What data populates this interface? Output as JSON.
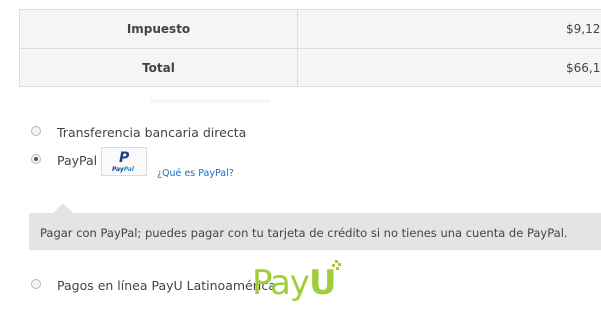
{
  "totals": {
    "rows": [
      {
        "label": "Impuesto",
        "value": "$9,12"
      },
      {
        "label": "Total",
        "value": "$66,1"
      }
    ]
  },
  "payment": {
    "options": [
      {
        "label": "Transferencia bancaria directa",
        "selected": false
      },
      {
        "label": "PayPal",
        "selected": true
      },
      {
        "label": "Pagos en línea PayU Latinoamérica",
        "selected": false
      }
    ],
    "paypal_logo": {
      "p": "P",
      "word_pay": "Pay",
      "word_pal": "Pal"
    },
    "paypal_link": "¿Qué es PayPal?",
    "paypal_description": "Pagar con PayPal; puedes pagar con tu tarjeta de crédito si no tienes una cuenta de PayPal.",
    "payu_logo": {
      "pay": "Pay",
      "u": "U"
    }
  },
  "colors": {
    "link": "#1a6fbf",
    "payu_green": "#9fce3a",
    "paypal_blue": "#1a3f8f",
    "description_bg": "#e6e3e7"
  }
}
